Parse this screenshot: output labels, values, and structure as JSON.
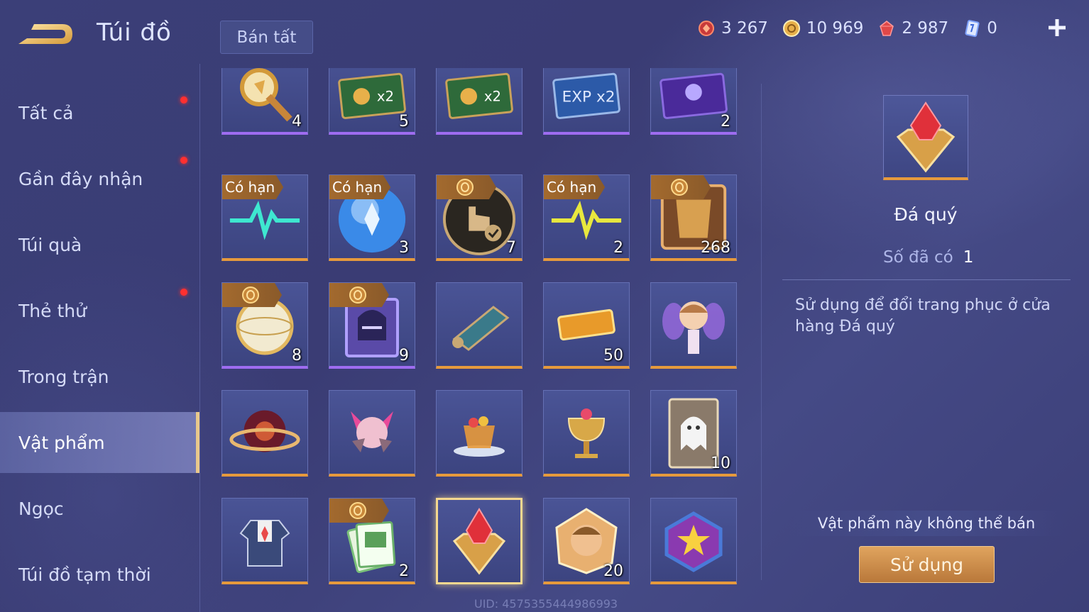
{
  "header": {
    "title": "Túi đồ",
    "sell_all": "Bán tất",
    "currencies": [
      {
        "icon": "voucher-red-icon",
        "value": "3 267"
      },
      {
        "icon": "gold-coin-icon",
        "value": "10 969"
      },
      {
        "icon": "ruby-icon",
        "value": "2 987"
      },
      {
        "icon": "blue-card-icon",
        "value": "0"
      }
    ]
  },
  "sidebar": {
    "items": [
      {
        "label": "Tất cả",
        "dot": true
      },
      {
        "label": "Gần đây nhận",
        "dot": true
      },
      {
        "label": "Túi quà",
        "dot": false
      },
      {
        "label": "Thẻ thử",
        "dot": true
      },
      {
        "label": "Trong trận",
        "dot": false
      },
      {
        "label": "Vật phẩm",
        "dot": false,
        "active": true
      },
      {
        "label": "Ngọc",
        "dot": false
      },
      {
        "label": "Túi đồ tạm thời",
        "dot": false
      }
    ]
  },
  "grid": {
    "limited_label": "Có hạn",
    "items": [
      {
        "icon": "golden-trophy-scepter-icon",
        "count": "4"
      },
      {
        "icon": "gold-x2-card-icon",
        "count": "5"
      },
      {
        "icon": "gold-x2-card-icon",
        "count": ""
      },
      {
        "icon": "exp-x2-card-icon",
        "count": ""
      },
      {
        "icon": "purple-emblem-card-icon",
        "count": "2"
      },
      {
        "icon": "teal-pulse-icon",
        "count": ""
      },
      {
        "icon": "blue-sky-orb-icon",
        "count": "3"
      },
      {
        "icon": "tap-check-icon",
        "count": "7"
      },
      {
        "icon": "yellow-pulse-icon",
        "count": "2"
      },
      {
        "icon": "golden-armor-card-icon",
        "count": "268"
      },
      {
        "icon": "pearl-orb-icon",
        "count": "8"
      },
      {
        "icon": "purple-helmet-card-icon",
        "count": "9"
      },
      {
        "icon": "map-scroll-icon",
        "count": ""
      },
      {
        "icon": "golden-ticket-icon",
        "count": "50"
      },
      {
        "icon": "fairy-chibi-icon",
        "count": ""
      },
      {
        "icon": "galaxy-orb-icon",
        "count": ""
      },
      {
        "icon": "pink-bat-pet-icon",
        "count": ""
      },
      {
        "icon": "fruit-tea-cup-icon",
        "count": ""
      },
      {
        "icon": "golden-chalice-icon",
        "count": ""
      },
      {
        "icon": "ghost-card-icon",
        "count": "10"
      },
      {
        "icon": "costume-icon",
        "count": ""
      },
      {
        "icon": "green-cards-icon",
        "count": "2"
      },
      {
        "icon": "gemstone-icon",
        "count": ""
      },
      {
        "icon": "hero-portrait-icon",
        "count": "20"
      },
      {
        "icon": "star-emblem-icon",
        "count": ""
      }
    ]
  },
  "detail": {
    "name": "Đá quý",
    "owned_label": "Số đã có",
    "owned_count": "1",
    "description": "Sử dụng để đổi trang phục ở cửa hàng Đá quý",
    "note": "Vật phẩm này không thể bán",
    "use_button": "Sử dụng"
  },
  "footer": {
    "uid": "UID: 4575355444986993"
  }
}
